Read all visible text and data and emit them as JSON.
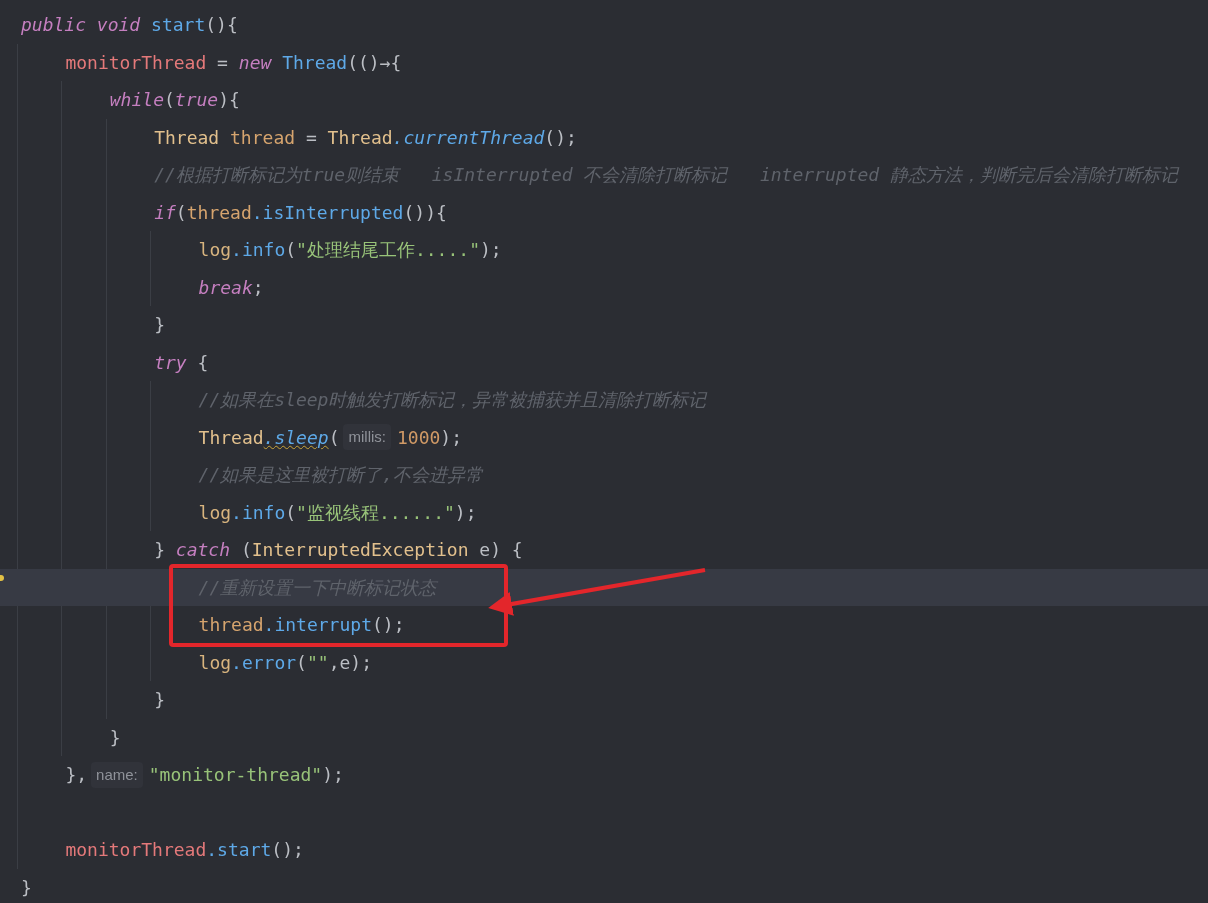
{
  "editor": {
    "lines": [
      {
        "kind": "code",
        "current": false,
        "tokens": [
          {
            "text": "public ",
            "kind": "keyword"
          },
          {
            "text": "void ",
            "kind": "keyword"
          },
          {
            "text": "start",
            "kind": "method"
          },
          {
            "text": "(){",
            "kind": "plain"
          }
        ],
        "children": [
          {
            "kind": "code",
            "current": false,
            "tokens": [
              {
                "text": "monitorThread",
                "kind": "field"
              },
              {
                "text": " = ",
                "kind": "plain"
              },
              {
                "text": "new ",
                "kind": "keyword"
              },
              {
                "text": "Thread",
                "kind": "method"
              },
              {
                "text": "(()→{",
                "kind": "plain"
              }
            ],
            "children": [
              {
                "kind": "code",
                "current": false,
                "tokens": [
                  {
                    "text": "while",
                    "kind": "keyword"
                  },
                  {
                    "text": "(",
                    "kind": "plain"
                  },
                  {
                    "text": "true",
                    "kind": "keyword"
                  },
                  {
                    "text": "){",
                    "kind": "plain"
                  }
                ],
                "children": [
                  {
                    "kind": "code",
                    "current": false,
                    "tokens": [
                      {
                        "text": "Thread ",
                        "kind": "type"
                      },
                      {
                        "text": "thread",
                        "kind": "local"
                      },
                      {
                        "text": " = ",
                        "kind": "plain"
                      },
                      {
                        "text": "Thread",
                        "kind": "type"
                      },
                      {
                        "text": ".currentThread",
                        "kind": "static_method"
                      },
                      {
                        "text": "();",
                        "kind": "plain"
                      }
                    ]
                  },
                  {
                    "kind": "code",
                    "current": false,
                    "tokens": [
                      {
                        "text": "//根据打断标记为true则结束   isInterrupted 不会清除打断标记   interrupted 静态方法，判断完后会清除打断标记",
                        "kind": "comment"
                      }
                    ]
                  },
                  {
                    "kind": "code",
                    "current": false,
                    "tokens": [
                      {
                        "text": "if",
                        "kind": "keyword"
                      },
                      {
                        "text": "(",
                        "kind": "plain"
                      },
                      {
                        "text": "thread",
                        "kind": "local"
                      },
                      {
                        "text": ".isInterrupted",
                        "kind": "method"
                      },
                      {
                        "text": "()){",
                        "kind": "plain"
                      }
                    ],
                    "children": [
                      {
                        "kind": "code",
                        "current": false,
                        "tokens": [
                          {
                            "text": "log",
                            "kind": "static_field"
                          },
                          {
                            "text": ".info",
                            "kind": "method"
                          },
                          {
                            "text": "(",
                            "kind": "plain"
                          },
                          {
                            "text": "\"处理结尾工作.....\"",
                            "kind": "string"
                          },
                          {
                            "text": ");",
                            "kind": "plain"
                          }
                        ]
                      },
                      {
                        "kind": "code",
                        "current": false,
                        "tokens": [
                          {
                            "text": "break",
                            "kind": "keyword"
                          },
                          {
                            "text": ";",
                            "kind": "plain"
                          }
                        ]
                      }
                    ]
                  },
                  {
                    "kind": "code",
                    "current": false,
                    "tokens": [
                      {
                        "text": "}",
                        "kind": "plain"
                      }
                    ]
                  },
                  {
                    "kind": "code",
                    "current": false,
                    "tokens": [
                      {
                        "text": "try",
                        "kind": "keyword"
                      },
                      {
                        "text": " {",
                        "kind": "plain"
                      }
                    ],
                    "children": [
                      {
                        "kind": "code",
                        "current": false,
                        "tokens": [
                          {
                            "text": "//如果在sleep时触发打断标记，异常被捕获并且清除打断标记",
                            "kind": "comment"
                          }
                        ]
                      },
                      {
                        "kind": "code",
                        "current": false,
                        "tokens": [
                          {
                            "text": "Thread",
                            "kind": "type"
                          },
                          {
                            "text": ".sleep",
                            "kind": "static_method",
                            "warning": true
                          },
                          {
                            "text": "(",
                            "kind": "plain"
                          },
                          {
                            "text": "millis:",
                            "kind": "hint"
                          },
                          {
                            "text": "1000",
                            "kind": "number"
                          },
                          {
                            "text": ");",
                            "kind": "plain"
                          }
                        ]
                      },
                      {
                        "kind": "code",
                        "current": false,
                        "tokens": [
                          {
                            "text": "//如果是这里被打断了,不会进异常",
                            "kind": "comment"
                          }
                        ]
                      },
                      {
                        "kind": "code",
                        "current": false,
                        "tokens": [
                          {
                            "text": "log",
                            "kind": "static_field"
                          },
                          {
                            "text": ".info",
                            "kind": "method"
                          },
                          {
                            "text": "(",
                            "kind": "plain"
                          },
                          {
                            "text": "\"监视线程......\"",
                            "kind": "string"
                          },
                          {
                            "text": ");",
                            "kind": "plain"
                          }
                        ]
                      }
                    ]
                  },
                  {
                    "kind": "code",
                    "current": false,
                    "tokens": [
                      {
                        "text": "} ",
                        "kind": "plain"
                      },
                      {
                        "text": "catch",
                        "kind": "keyword"
                      },
                      {
                        "text": " (",
                        "kind": "plain"
                      },
                      {
                        "text": "InterruptedException",
                        "kind": "type"
                      },
                      {
                        "text": " e) {",
                        "kind": "plain"
                      }
                    ],
                    "children": [
                      {
                        "kind": "code",
                        "current": true,
                        "tokens": [
                          {
                            "text": "//重新设置一下中断标记状态",
                            "kind": "comment"
                          }
                        ]
                      },
                      {
                        "kind": "code",
                        "current": false,
                        "tokens": [
                          {
                            "text": "thread",
                            "kind": "local"
                          },
                          {
                            "text": ".interrupt",
                            "kind": "method"
                          },
                          {
                            "text": "();",
                            "kind": "plain"
                          }
                        ]
                      },
                      {
                        "kind": "code",
                        "current": false,
                        "tokens": [
                          {
                            "text": "log",
                            "kind": "static_field"
                          },
                          {
                            "text": ".error",
                            "kind": "method"
                          },
                          {
                            "text": "(",
                            "kind": "plain"
                          },
                          {
                            "text": "\"\"",
                            "kind": "string"
                          },
                          {
                            "text": ",e);",
                            "kind": "plain"
                          }
                        ]
                      }
                    ]
                  },
                  {
                    "kind": "code",
                    "current": false,
                    "tokens": [
                      {
                        "text": "}",
                        "kind": "plain"
                      }
                    ]
                  }
                ]
              },
              {
                "kind": "code",
                "current": false,
                "tokens": [
                  {
                    "text": "}",
                    "kind": "plain"
                  }
                ]
              }
            ]
          },
          {
            "kind": "code",
            "current": false,
            "tokens": [
              {
                "text": "},",
                "kind": "plain"
              },
              {
                "text": "name:",
                "kind": "hint"
              },
              {
                "text": "\"monitor-thread\"",
                "kind": "string"
              },
              {
                "text": ");",
                "kind": "plain"
              }
            ]
          },
          {
            "kind": "blank",
            "current": false
          },
          {
            "kind": "code",
            "current": false,
            "tokens": [
              {
                "text": "monitorThread",
                "kind": "field"
              },
              {
                "text": ".start",
                "kind": "method"
              },
              {
                "text": "();",
                "kind": "plain"
              }
            ]
          }
        ]
      },
      {
        "kind": "code",
        "current": false,
        "tokens": [
          {
            "text": "}",
            "kind": "plain"
          }
        ]
      }
    ]
  }
}
